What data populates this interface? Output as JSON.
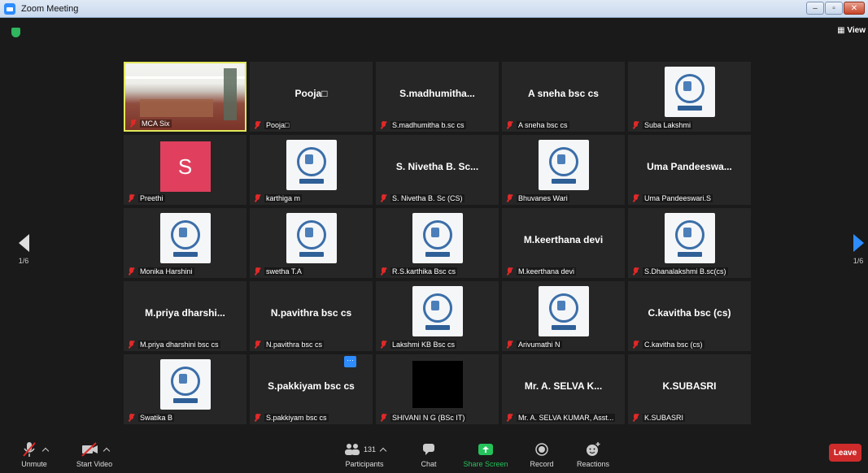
{
  "window": {
    "title": "Zoom Meeting",
    "controls": {
      "minimize": "–",
      "maximize": "▫",
      "close": "✕"
    }
  },
  "header": {
    "view_label": "View"
  },
  "pager": {
    "left": "1/6",
    "right": "1/6"
  },
  "tiles": [
    {
      "kind": "video",
      "big": "",
      "label": "MCA Six",
      "icon": "camera-feed"
    },
    {
      "kind": "name",
      "big": "Pooja□",
      "label": "Pooja□"
    },
    {
      "kind": "name",
      "big": "S.madhumitha...",
      "label": "S.madhumitha b.sc cs"
    },
    {
      "kind": "name",
      "big": "A sneha bsc cs",
      "label": "A sneha bsc cs"
    },
    {
      "kind": "logo",
      "big": "",
      "label": "Suba Lakshmi"
    },
    {
      "kind": "avatar",
      "big": "S",
      "label": "Preethi"
    },
    {
      "kind": "logo",
      "big": "",
      "label": "karthiga m"
    },
    {
      "kind": "name",
      "big": "S. Nivetha B. Sc...",
      "label": "S. Nivetha B. Sc (CS)"
    },
    {
      "kind": "logo",
      "big": "",
      "label": "Bhuvanes Wari"
    },
    {
      "kind": "name",
      "big": "Uma Pandeeswa...",
      "label": "Uma Pandeeswari.S"
    },
    {
      "kind": "logo",
      "big": "",
      "label": "Monika Harshini"
    },
    {
      "kind": "logo",
      "big": "",
      "label": "swetha T.A"
    },
    {
      "kind": "logo",
      "big": "",
      "label": "R.S.karthika Bsc cs"
    },
    {
      "kind": "name",
      "big": "M.keerthana devi",
      "label": "M.keerthana devi"
    },
    {
      "kind": "logo",
      "big": "",
      "label": "S.Dhanalakshmi B.sc(cs)"
    },
    {
      "kind": "name",
      "big": "M.priya  dharshi...",
      "label": "M.priya dharshini bsc cs"
    },
    {
      "kind": "name",
      "big": "N.pavithra bsc cs",
      "label": "N.pavithra bsc cs"
    },
    {
      "kind": "logo",
      "big": "",
      "label": "Lakshmi KB Bsc cs"
    },
    {
      "kind": "logo",
      "big": "",
      "label": "Arivumathi N"
    },
    {
      "kind": "name",
      "big": "C.kavitha bsc (cs)",
      "label": "C.kavitha bsc (cs)"
    },
    {
      "kind": "logo",
      "big": "",
      "label": "Swatika B"
    },
    {
      "kind": "name",
      "big": "S.pakkiyam bsc cs",
      "label": "S.pakkiyam bsc cs",
      "more": "···"
    },
    {
      "kind": "black",
      "big": "",
      "label": "SHIVANI N G (BSc IT)"
    },
    {
      "kind": "name",
      "big": "Mr. A. SELVA K...",
      "label": "Mr. A. SELVA KUMAR, Asst..."
    },
    {
      "kind": "name",
      "big": "K.SUBASRI",
      "label": "K.SUBASRI"
    }
  ],
  "toolbar": {
    "unmute": "Unmute",
    "start_video": "Start Video",
    "participants": "Participants",
    "participants_count": "131",
    "chat": "Chat",
    "share_screen": "Share Screen",
    "record": "Record",
    "reactions": "Reactions",
    "leave": "Leave"
  },
  "colors": {
    "accent": "#2d8cff",
    "share_green": "#25c25c",
    "leave_red": "#cf2b2b",
    "muted_red": "#e02828",
    "active_speaker": "#e2e85a",
    "avatar_pink": "#e0405e"
  }
}
